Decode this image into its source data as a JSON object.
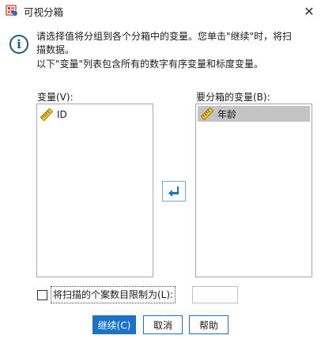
{
  "window": {
    "title": "可视分箱",
    "close_glyph": "✕",
    "icon": "app-icon"
  },
  "info": {
    "icon": "info-icon",
    "line1": "请选择值将分组到各个分箱中的变量。您单击\"继续\"时，将扫",
    "line2": "描数据。",
    "line3": "以下\"变量\"列表包含所有的数字有序变量和标度变量。"
  },
  "variables_list": {
    "label": "变量(V):",
    "items": [
      {
        "label": "ID",
        "icon": "ruler-icon",
        "selected": false
      }
    ]
  },
  "bin_list": {
    "label": "要分箱的变量(B):",
    "items": [
      {
        "label": "年龄",
        "icon": "ruler-icon",
        "selected": true
      }
    ]
  },
  "move_button": {
    "icon": "arrow-left-icon",
    "color": "#1a73c9"
  },
  "limit": {
    "checked": false,
    "label": "将扫描的个案数目限制为(L):",
    "value": ""
  },
  "buttons": {
    "continue": "继续(C)",
    "cancel": "取消",
    "help": "帮助"
  },
  "colors": {
    "accent": "#1a73c9",
    "info_icon": "#1d5a84",
    "selection": "#c4c4c4",
    "ruler": "#d9a514"
  }
}
